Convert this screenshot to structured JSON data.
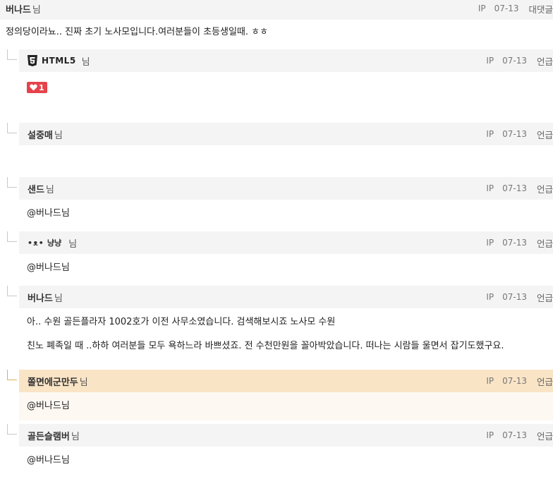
{
  "comments": [
    {
      "author": "버나드",
      "suffix": "님",
      "ip": "IP",
      "date": "07-13",
      "action": "대댓글",
      "text": "정의당이라뇨.. 진짜 초기 노사모입니다.여러분들이 초등생일때. ㅎㅎ"
    },
    {
      "author": "HTML5",
      "suffix": "님",
      "ip": "IP",
      "date": "07-13",
      "action": "언급",
      "like_count": "1"
    },
    {
      "author": "설중매",
      "suffix": "님",
      "ip": "IP",
      "date": "07-13",
      "action": "언급"
    },
    {
      "author": "샌드",
      "suffix": "님",
      "ip": "IP",
      "date": "07-13",
      "action": "언급",
      "text": "@버나드님"
    },
    {
      "author_emote": "•ᴥ•",
      "author": "냥냥",
      "suffix": "님",
      "ip": "IP",
      "date": "07-13",
      "action": "언급",
      "text": "@버나드님"
    },
    {
      "author": "버나드",
      "suffix": "님",
      "ip": "IP",
      "date": "07-13",
      "action": "언급",
      "text_line1": "아.. 수원 골든플라자 1002호가 이전 사무소였습니다. 검색해보시죠 노사모 수원",
      "text_line2": "친노 폐족일 때 ..하하 여러분들 모두 욕하느라 바쁘셨죠. 전 수천만원을 꼴아박았습니다. 떠나는 시람들 울면서 잡기도했구요."
    },
    {
      "author": "쫄면에군만두",
      "suffix": "님",
      "ip": "IP",
      "date": "07-13",
      "action": "언급",
      "text": "@버나드님"
    },
    {
      "author": "골든슬램버",
      "suffix": "님",
      "ip": "IP",
      "date": "07-13",
      "action": "언급",
      "text": "@버나드님"
    }
  ],
  "colors": {
    "header_bg": "#f4f4f4",
    "highlight_header_bg": "#f9e4c6",
    "highlight_body_bg": "#fdf8f2",
    "like_badge": "#e5434b"
  }
}
